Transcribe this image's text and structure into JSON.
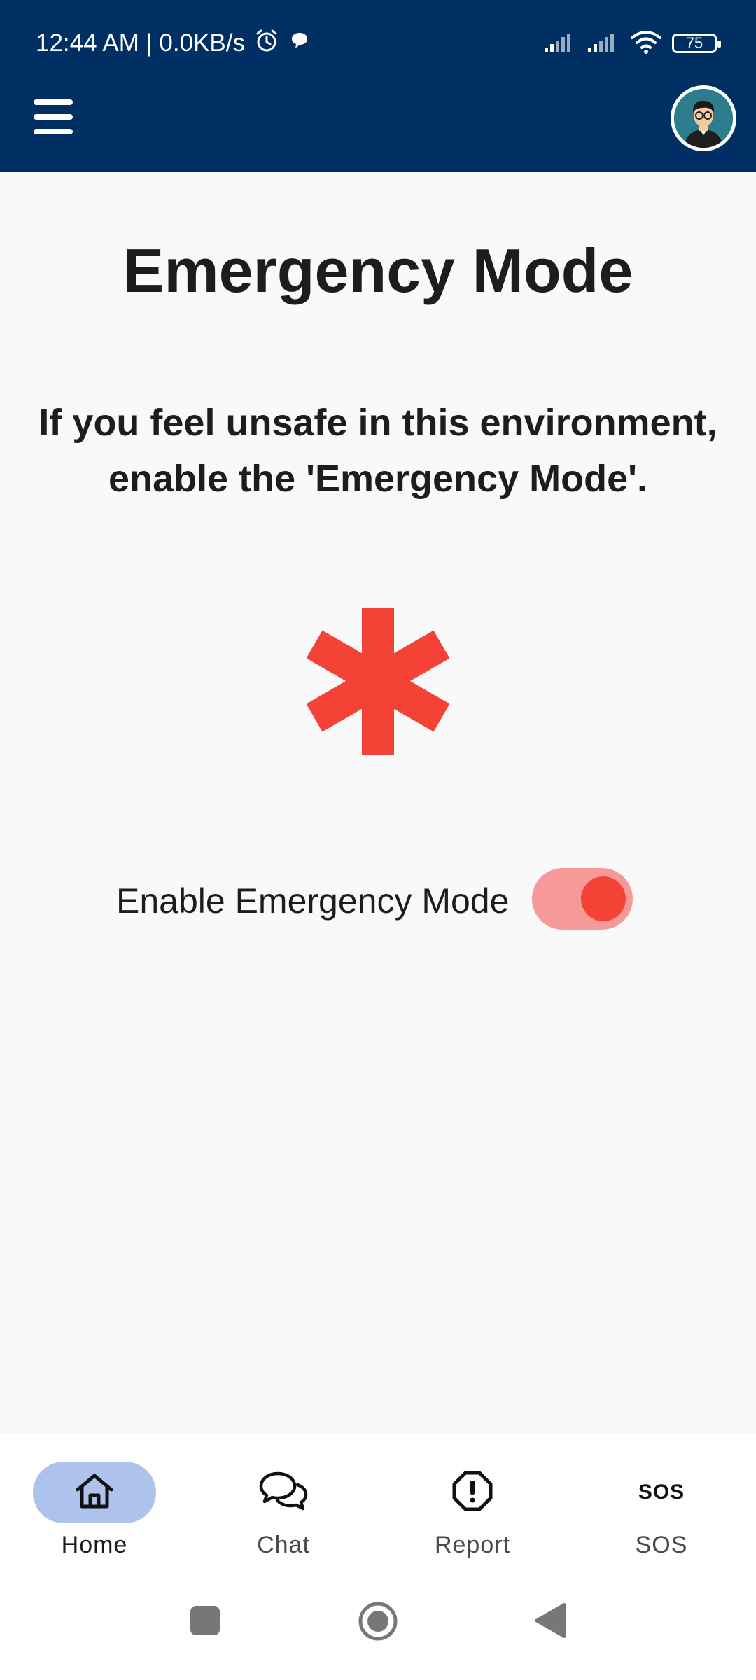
{
  "status_bar": {
    "time_speed": "12:44 AM | 0.0KB/s",
    "battery": "75"
  },
  "page": {
    "title": "Emergency Mode",
    "description_line1": "If you feel unsafe in this environment,",
    "description_line2": "enable the 'Emergency Mode'."
  },
  "toggle": {
    "label": "Enable Emergency Mode",
    "enabled": true
  },
  "bottom_nav": {
    "items": [
      {
        "label": "Home",
        "icon": "home-icon",
        "active": true
      },
      {
        "label": "Chat",
        "icon": "chat-icon",
        "active": false
      },
      {
        "label": "Report",
        "icon": "report-icon",
        "active": false
      },
      {
        "label": "SOS",
        "icon": "sos-icon",
        "active": false
      }
    ],
    "sos_icon_text": "SOS"
  },
  "colors": {
    "app_bar": "#003063",
    "accent_red": "#f44336",
    "active_nav_bg": "#adc3eb"
  }
}
